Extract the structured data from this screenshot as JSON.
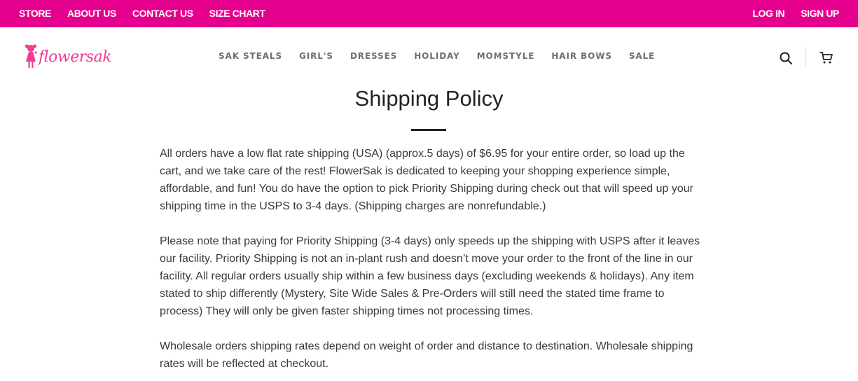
{
  "topbar": {
    "left_links": [
      "STORE",
      "ABOUT US",
      "CONTACT US",
      "SIZE CHART"
    ],
    "right_links": [
      "LOG IN",
      "SIGN UP"
    ],
    "background": "#e6008e"
  },
  "header": {
    "logo_text": "flowersak",
    "nav": [
      "SAK STEALS",
      "GIRL'S",
      "DRESSES",
      "HOLIDAY",
      "MOMSTYLE",
      "HAIR BOWS",
      "SALE"
    ],
    "icons": [
      "search-icon",
      "cart-icon"
    ]
  },
  "page": {
    "title": "Shipping Policy",
    "paragraphs": [
      "All orders have a low flat rate shipping (USA) (approx.5 days) of $6.95 for your entire order, so load up the cart, and we take care of the rest! FlowerSak is dedicated to keeping your shopping experience simple, affordable, and fun! You do have the option to pick Priority Shipping during check out that will speed up your shipping time in the USPS to 3-4 days. (Shipping charges are nonrefundable.)",
      "Please note that paying for Priority Shipping (3-4 days) only speeds up the shipping with USPS after it leaves our facility. Priority Shipping is not an in-plant rush and doesn’t move your order to the front of the line in our facility. All regular orders usually ship within a few business days (excluding weekends & holidays). Any item stated to ship differently (Mystery, Site Wide Sales & Pre-Orders will still need the stated time frame to process) They will only be given faster shipping times not processing times.",
      "Wholesale orders shipping rates depend on weight of order and distance to destination. Wholesale shipping rates will be reflected at checkout."
    ]
  }
}
